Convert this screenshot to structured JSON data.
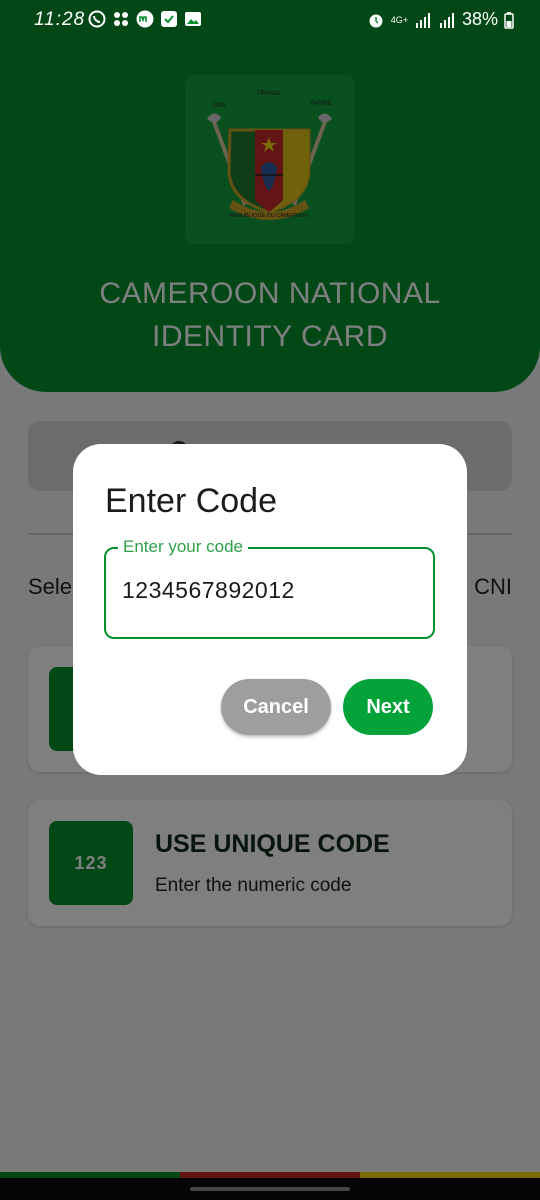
{
  "status_bar": {
    "time": "11:28",
    "network": "4G+",
    "battery": "38%",
    "icons_left": [
      "whatsapp-icon",
      "dots-icon",
      "m-app-icon",
      "check-icon",
      "image-icon"
    ],
    "icons_right": [
      "alarm-icon",
      "signal-icon",
      "signal-icon-2",
      "battery-icon"
    ]
  },
  "header": {
    "title_line1": "CAMEROON NATIONAL",
    "title_line2": "IDENTITY CARD",
    "emblem_top_text": "TRAVAIL",
    "emblem_left_text": "PAIX",
    "emblem_right_text": "PATRIE",
    "emblem_banner_text": "REPUBLIQUE DU CAMEROUN",
    "color": "#04912d"
  },
  "main": {
    "select_text_left": "Sele",
    "select_text_right": "CNI",
    "options": [
      {
        "title": "",
        "subtitle": "",
        "icon": "scan-icon"
      },
      {
        "title": "USE UNIQUE CODE",
        "subtitle": "Enter the numeric code",
        "icon_text": "123"
      }
    ]
  },
  "dialog": {
    "title": "Enter Code",
    "field_label": "Enter your code",
    "field_value": "1234567892012",
    "cancel_label": "Cancel",
    "next_label": "Next"
  },
  "colors": {
    "flag_green": "#04912d",
    "flag_red": "#c62828",
    "flag_yellow": "#f5d90a",
    "accent": "#04a33a"
  }
}
